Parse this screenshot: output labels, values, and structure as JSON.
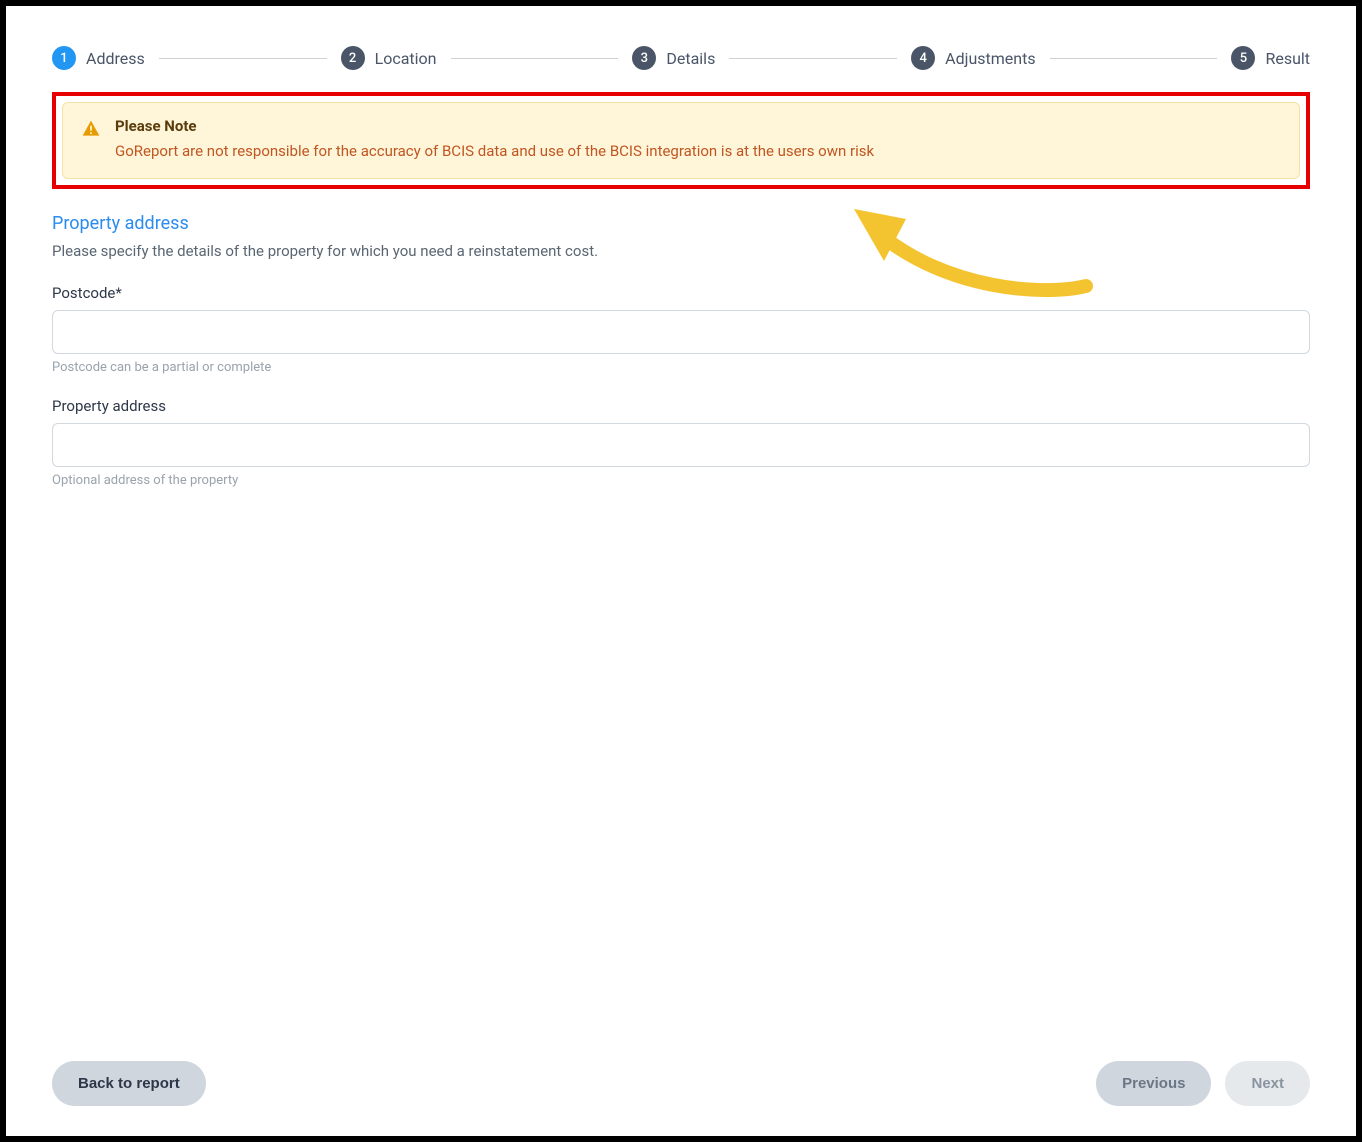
{
  "stepper": {
    "steps": [
      {
        "num": "1",
        "label": "Address",
        "active": true
      },
      {
        "num": "2",
        "label": "Location",
        "active": false
      },
      {
        "num": "3",
        "label": "Details",
        "active": false
      },
      {
        "num": "4",
        "label": "Adjustments",
        "active": false
      },
      {
        "num": "5",
        "label": "Result",
        "active": false
      }
    ]
  },
  "alert": {
    "title": "Please Note",
    "body": "GoReport are not responsible for the accuracy of BCIS data and use of the BCIS integration is at the users own risk"
  },
  "section": {
    "title": "Property address",
    "desc": "Please specify the details of the property for which you need a reinstatement cost."
  },
  "fields": {
    "postcode": {
      "label": "Postcode*",
      "value": "",
      "hint": "Postcode can be a partial or complete"
    },
    "address": {
      "label": "Property address",
      "value": "",
      "hint": "Optional address of the property"
    }
  },
  "footer": {
    "back": "Back to report",
    "previous": "Previous",
    "next": "Next"
  }
}
